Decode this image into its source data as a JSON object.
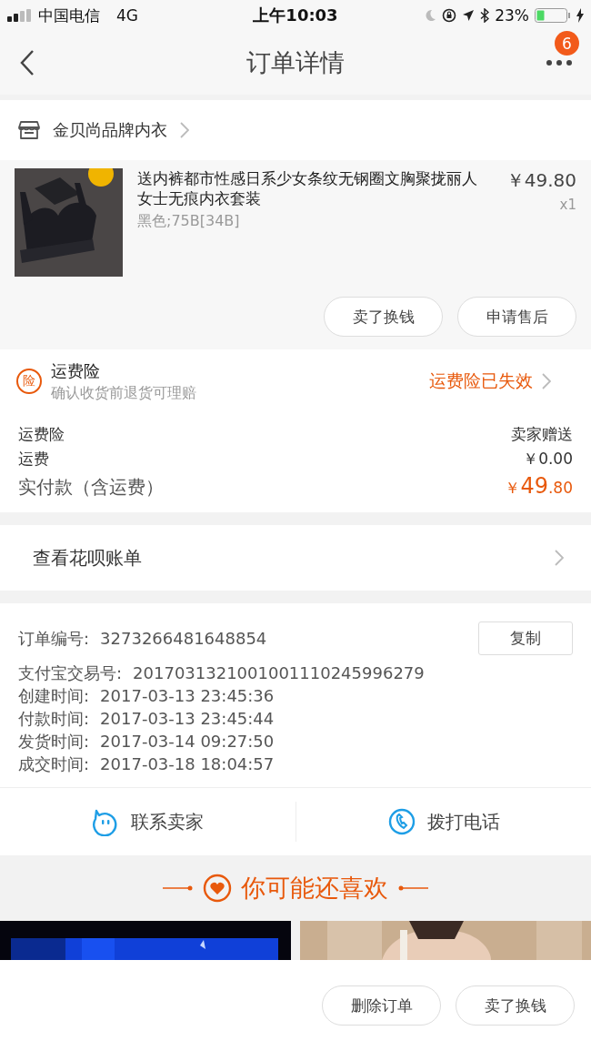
{
  "status_bar": {
    "carrier": "中国电信",
    "network": "4G",
    "time": "上午10:03",
    "battery": "23%"
  },
  "nav": {
    "title": "订单详情",
    "badge": "6"
  },
  "shop": {
    "name": "金贝尚品牌内衣"
  },
  "product": {
    "title": "送内裤都市性感日系少女条纹无钢圈文胸聚拢丽人女士无痕内衣套装",
    "sku": "黑色;75B[34B]",
    "price": "￥49.80",
    "quantity": "x1"
  },
  "product_actions": [
    "卖了换钱",
    "申请售后"
  ],
  "insurance": {
    "mark": "险",
    "title": "运费险",
    "subtitle": "确认收货前退货可理赔",
    "status": "运费险已失效"
  },
  "fees": [
    {
      "label": "运费险",
      "value": "卖家赠送"
    },
    {
      "label": "运费",
      "value": "￥0.00"
    }
  ],
  "total": {
    "label": "实付款（含运费）",
    "currency": "￥",
    "integer": "49",
    "decimal": ".80"
  },
  "huabei": {
    "label": "查看花呗账单"
  },
  "order_info": {
    "copy_button": "复制",
    "rows": [
      {
        "label": "订单编号:",
        "value": "3273266481648854"
      },
      {
        "label": "支付宝交易号:",
        "value": "2017031321001001110245996279"
      },
      {
        "label": "创建时间:",
        "value": "2017-03-13 23:45:36"
      },
      {
        "label": "付款时间:",
        "value": "2017-03-13 23:45:44"
      },
      {
        "label": "发货时间:",
        "value": "2017-03-14 09:27:50"
      },
      {
        "label": "成交时间:",
        "value": "2017-03-18 18:04:57"
      }
    ]
  },
  "contact": [
    {
      "kind": "chat",
      "label": "联系卖家"
    },
    {
      "kind": "phone",
      "label": "拨打电话"
    }
  ],
  "recommend": {
    "title": "你可能还喜欢"
  },
  "bottom_actions": [
    "删除订单",
    "卖了换钱"
  ]
}
